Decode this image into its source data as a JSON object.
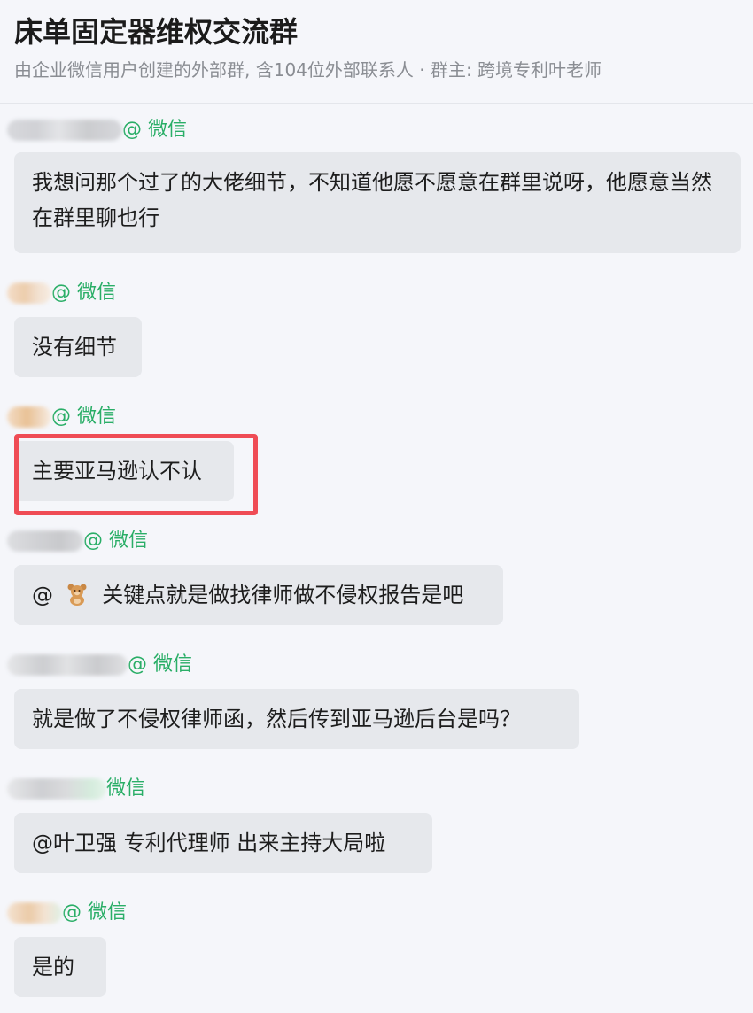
{
  "header": {
    "title": "床单固定器维权交流群",
    "subtitle": "由企业微信用户创建的外部群, 含104位外部联系人 · 群主: 跨境专利叶老师"
  },
  "messages": [
    {
      "tag": "@ 微信",
      "text": "我想问那个过了的大佬细节，不知道他愿不愿意在群里说呀，他愿意当然在群里聊也行"
    },
    {
      "tag": "@ 微信",
      "text": "没有细节"
    },
    {
      "tag": "@ 微信",
      "text": "主要亚马逊认不认"
    },
    {
      "tag": "@ 微信",
      "text_prefix": "@",
      "text": "关键点就是做找律师做不侵权报告是吧"
    },
    {
      "tag": "@ 微信",
      "text": "就是做了不侵权律师函，然后传到亚马逊后台是吗？"
    },
    {
      "tag": "微信",
      "text": "@叶卫强 专利代理师 出来主持大局啦"
    },
    {
      "tag": "@ 微信",
      "text": "是的"
    }
  ],
  "colors": {
    "wechat_green": "#2aae67",
    "bubble": "#e6e8ec",
    "highlight": "#ef4c55",
    "background": "#f5f6fa"
  },
  "icons": {
    "mention_avatar": "teddy-bear-icon"
  }
}
